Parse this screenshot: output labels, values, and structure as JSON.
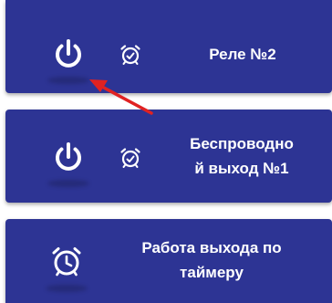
{
  "colors": {
    "panel": "#2d3494",
    "icon": "#ffffff",
    "annotation_arrow": "#e02222"
  },
  "cards": [
    {
      "label": "Реле №2",
      "main_icon": "power-icon",
      "secondary_icon": "alarm-clock-check-icon"
    },
    {
      "label_line1": "Беспроводно",
      "label_line2": "й выход №1",
      "main_icon": "power-icon",
      "secondary_icon": "alarm-clock-check-icon"
    },
    {
      "label_line1": "Работа выхода по",
      "label_line2": "таймеру",
      "main_icon": "alarm-clock-icon"
    }
  ],
  "annotation": {
    "icon": "red-arrow-icon",
    "points_to": "power-button"
  }
}
